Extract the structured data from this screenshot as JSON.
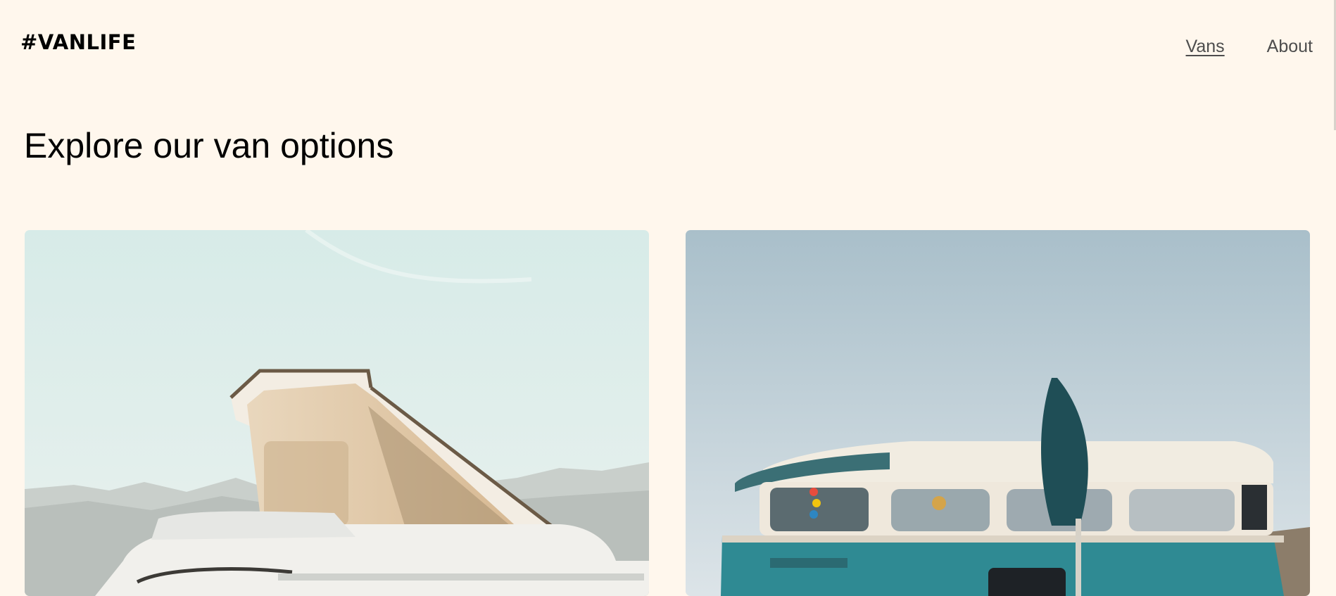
{
  "header": {
    "logo": "#VANLIFE",
    "nav": [
      {
        "label": "Vans",
        "active": true
      },
      {
        "label": "About",
        "active": false
      }
    ]
  },
  "main": {
    "title": "Explore our van options"
  },
  "colors": {
    "background": "#fff7ed",
    "text": "#161616",
    "nav_text": "#4d4d4d"
  }
}
